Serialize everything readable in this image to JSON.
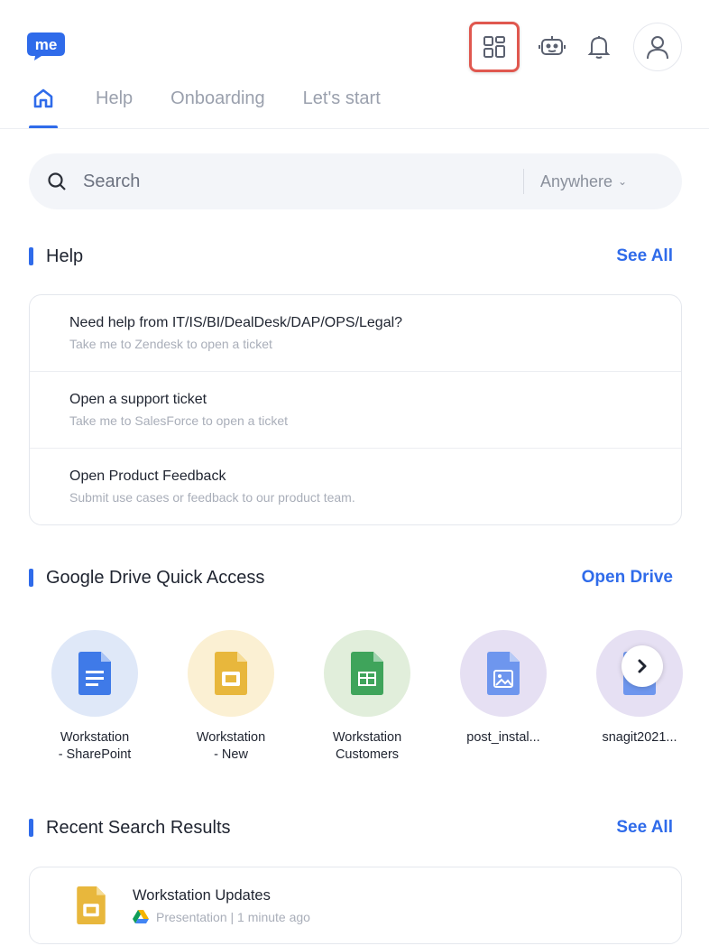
{
  "header": {
    "logo_text": "me",
    "icons": [
      "apps-grid-icon",
      "bot-icon",
      "bell-icon",
      "user-icon"
    ]
  },
  "nav": {
    "tabs": [
      {
        "label": "Help"
      },
      {
        "label": "Onboarding"
      },
      {
        "label": "Let's start"
      }
    ]
  },
  "search": {
    "placeholder": "Search",
    "scope": "Anywhere"
  },
  "help": {
    "title": "Help",
    "see_all": "See All",
    "items": [
      {
        "title": "Need help from IT/IS/BI/DealDesk/DAP/OPS/Legal?",
        "subtitle": "Take me to Zendesk to open a ticket"
      },
      {
        "title": "Open a support ticket",
        "subtitle": "Take me to SalesForce to open a ticket"
      },
      {
        "title": "Open Product Feedback",
        "subtitle": "Submit use cases or feedback to our product team."
      }
    ]
  },
  "drive": {
    "title": "Google Drive Quick Access",
    "open_link": "Open Drive",
    "items": [
      {
        "line1": "Workstation",
        "line2": "- SharePoint",
        "type": "doc",
        "bg": "#dfe8f8",
        "color": "#3f7ae8"
      },
      {
        "line1": "Workstation",
        "line2": "- New",
        "type": "slides",
        "bg": "#fbf0d3",
        "color": "#e8b73c"
      },
      {
        "line1": "Workstation",
        "line2": "Customers",
        "type": "sheets",
        "bg": "#e1eedb",
        "color": "#3fa45b"
      },
      {
        "line1": "post_instal...",
        "line2": "",
        "type": "image",
        "bg": "#e6e0f3",
        "color": "#6e96ee"
      },
      {
        "line1": "snagit2021...",
        "line2": "",
        "type": "doc",
        "bg": "#e6e0f3",
        "color": "#6e96ee"
      }
    ]
  },
  "recent": {
    "title": "Recent Search Results",
    "see_all": "See All",
    "items": [
      {
        "title": "Workstation Updates",
        "meta": "Presentation | 1 minute ago"
      }
    ]
  },
  "colors": {
    "accent": "#2f6bea",
    "highlight_border": "#e0584f"
  }
}
